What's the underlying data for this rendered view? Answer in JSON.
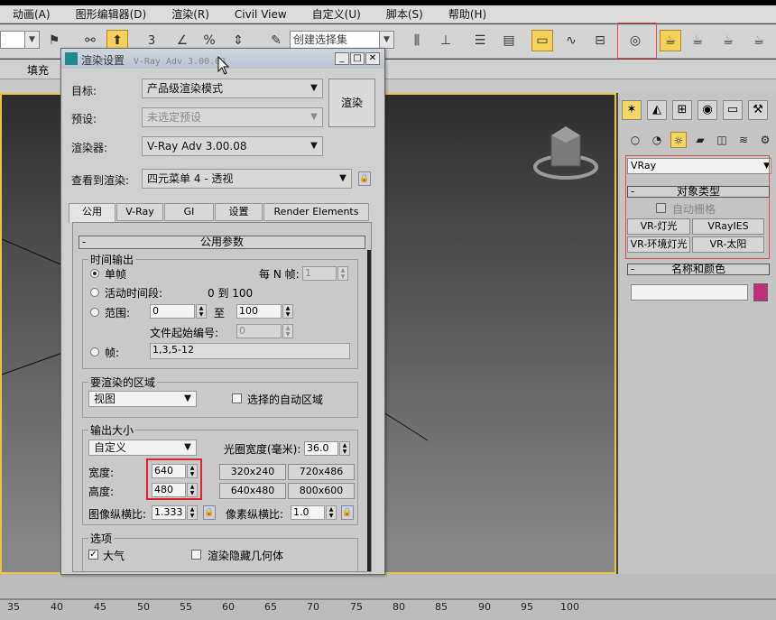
{
  "menubar": {
    "items": [
      "动画(A)",
      "图形编辑器(D)",
      "渲染(R)",
      "Civil View",
      "自定义(U)",
      "脚本(S)",
      "帮助(H)"
    ]
  },
  "toolbar": {
    "selection_set_placeholder": "创建选择集",
    "fill_label": "填充",
    "number_3": "3"
  },
  "dialog": {
    "title": "渲染设置",
    "title_suffix": "V-Ray Adv 3.00.08",
    "target_label": "目标:",
    "target_value": "产品级渲染模式",
    "preset_label": "预设:",
    "preset_value": "未选定预设",
    "renderer_label": "渲染器:",
    "renderer_value": "V-Ray Adv 3.00.08",
    "view_label": "查看到渲染:",
    "view_value": "四元菜单 4 - 透视",
    "render_button": "渲染",
    "tabs": [
      "公用",
      "V-Ray",
      "GI",
      "设置",
      "Render Elements"
    ],
    "rollout_title": "公用参数",
    "time_output": {
      "title": "时间输出",
      "single": "单帧",
      "every_n_label": "每 N 帧:",
      "every_n_value": "1",
      "active": "活动时间段:",
      "active_range": "0 到 100",
      "range": "范围:",
      "range_from": "0",
      "range_to_label": "至",
      "range_to": "100",
      "file_start_label": "文件起始编号:",
      "file_start_value": "0",
      "frames": "帧:",
      "frames_value": "1,3,5-12"
    },
    "area": {
      "title": "要渲染的区域",
      "value": "视图",
      "auto_region": "选择的自动区域"
    },
    "output_size": {
      "title": "输出大小",
      "preset": "自定义",
      "aperture_label": "光圈宽度(毫米):",
      "aperture_value": "36.0",
      "width_label": "宽度:",
      "width_value": "640",
      "height_label": "高度:",
      "height_value": "480",
      "presets": [
        "320x240",
        "720x486",
        "640x480",
        "800x600"
      ],
      "image_aspect_label": "图像纵横比:",
      "image_aspect_value": "1.333",
      "pixel_aspect_label": "像素纵横比:",
      "pixel_aspect_value": "1.0"
    },
    "options": {
      "title": "选项",
      "atmosphere": "大气",
      "render_hidden": "渲染隐藏几何体"
    }
  },
  "command_panel": {
    "category": "VRay",
    "object_type_title": "对象类型",
    "auto_grid": "自动栅格",
    "buttons": [
      "VR-灯光",
      "VRayIES",
      "VR-环境灯光",
      "VR-太阳"
    ],
    "name_color_title": "名称和颜色",
    "swatch_color": "#c0307a"
  },
  "timeline": {
    "ticks": [
      "35",
      "40",
      "45",
      "50",
      "55",
      "60",
      "65",
      "70",
      "75",
      "80",
      "85",
      "90",
      "95",
      "100"
    ]
  },
  "colors": {
    "viewport_border": "#e8c640",
    "highlight_red": "#e2202a"
  }
}
